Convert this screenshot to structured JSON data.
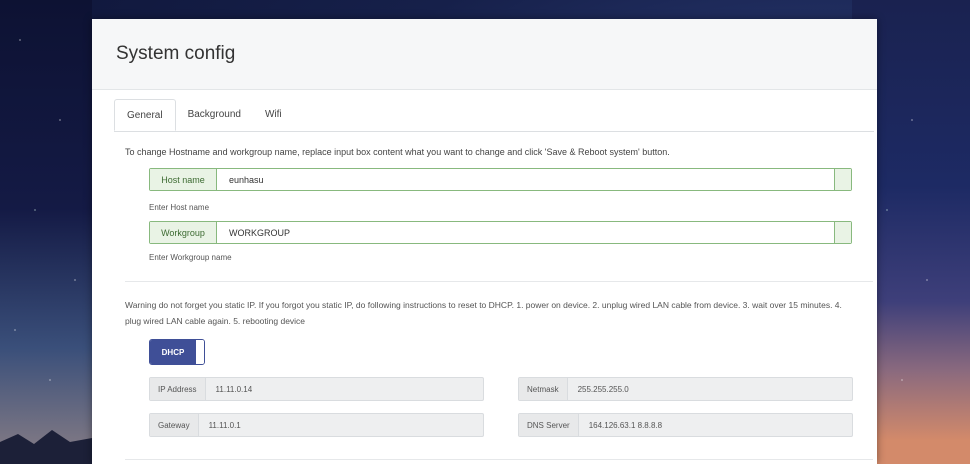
{
  "page": {
    "title": "System config"
  },
  "tabs": [
    {
      "label": "General",
      "active": true
    },
    {
      "label": "Background",
      "active": false
    },
    {
      "label": "Wifi",
      "active": false
    }
  ],
  "general": {
    "intro": "To change Hostname and workgroup name, replace input box content what you want to change and click 'Save & Reboot system' button.",
    "hostname": {
      "label": "Host name",
      "value": "eunhasu",
      "help": "Enter Host name"
    },
    "workgroup": {
      "label": "Workgroup",
      "value": "WORKGROUP",
      "help": "Enter Workgroup name"
    },
    "warning": "Warning do not forget you static IP. If you forgot you static IP, do following instructions to reset to DHCP. 1. power on device. 2. unplug wired LAN cable from device. 3. wait over 15 minutes. 4. plug wired LAN cable again. 5. rebooting device",
    "dhcp": {
      "label": "DHCP"
    },
    "network": {
      "ip": {
        "label": "IP Address",
        "value": "11.11.0.14"
      },
      "netmask": {
        "label": "Netmask",
        "value": "255.255.255.0"
      },
      "gateway": {
        "label": "Gateway",
        "value": "11.11.0.1"
      },
      "dns": {
        "label": "DNS Server",
        "value": "164.126.63.1 8.8.8.8"
      }
    }
  },
  "colors": {
    "accent_green": "#88b97e",
    "dhcp_blue": "#3f4f97"
  }
}
